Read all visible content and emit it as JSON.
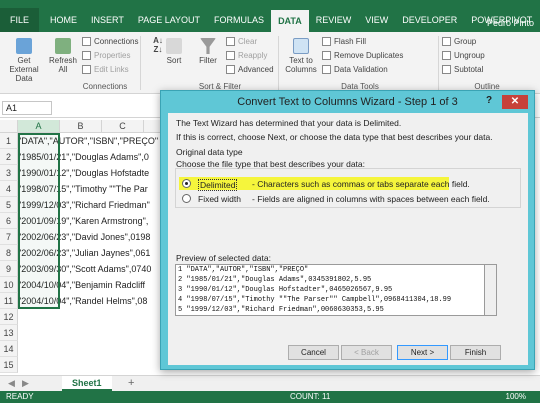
{
  "app": {
    "title_partial": "Book1 - Exc",
    "user": "Pedro Pinto"
  },
  "ribbon_tabs": [
    "FILE",
    "HOME",
    "INSERT",
    "PAGE LAYOUT",
    "FORMULAS",
    "DATA",
    "REVIEW",
    "VIEW",
    "DEVELOPER",
    "POWERPIVOT"
  ],
  "active_tab": "DATA",
  "ribbon": {
    "get_external_data": "Get External Data",
    "refresh_all": "Refresh All",
    "connections": "Connections",
    "properties": "Properties",
    "edit_links": "Edit Links",
    "group_connections": "Connections",
    "sort": "Sort",
    "filter": "Filter",
    "clear": "Clear",
    "reapply": "Reapply",
    "advanced": "Advanced",
    "group_sort_filter": "Sort & Filter",
    "text_to_columns": "Text to Columns",
    "flash_fill": "Flash Fill",
    "remove_duplicates": "Remove Duplicates",
    "data_validation": "Data Validation",
    "group_data_tools": "Data Tools",
    "group": "Group",
    "ungroup": "Ungroup",
    "subtotal": "Subtotal",
    "group_outline": "Outline"
  },
  "name_box": "A1",
  "columns": [
    "A",
    "B",
    "C"
  ],
  "rows": [
    {
      "n": "1",
      "v": "\"DATA\",\"AUTOR\",\"ISBN\",\"PREÇO\""
    },
    {
      "n": "2",
      "v": "\"1985/01/21\",\"Douglas Adams\",0"
    },
    {
      "n": "3",
      "v": "\"1990/01/12\",\"Douglas Hofstadte"
    },
    {
      "n": "4",
      "v": "\"1998/07/15\",\"Timothy \"\"The Par"
    },
    {
      "n": "5",
      "v": "\"1999/12/03\",\"Richard Friedman\""
    },
    {
      "n": "6",
      "v": "\"2001/09/19\",\"Karen Armstrong\","
    },
    {
      "n": "7",
      "v": "\"2002/06/23\",\"David Jones\",0198"
    },
    {
      "n": "8",
      "v": "\"2002/06/23\",\"Julian Jaynes\",061"
    },
    {
      "n": "9",
      "v": "\"2003/09/30\",\"Scott Adams\",0740"
    },
    {
      "n": "10",
      "v": "\"2004/10/04\",\"Benjamin Radcliff"
    },
    {
      "n": "11",
      "v": "\"2004/10/04\",\"Randel Helms\",08"
    },
    {
      "n": "12",
      "v": ""
    },
    {
      "n": "13",
      "v": ""
    },
    {
      "n": "14",
      "v": ""
    },
    {
      "n": "15",
      "v": ""
    }
  ],
  "sheet_tab": "Sheet1",
  "add_sheet": "+",
  "status": {
    "ready": "READY",
    "count": "COUNT: 11",
    "zoom": "100%"
  },
  "dialog": {
    "title": "Convert Text to Columns Wizard - Step 1 of 3",
    "help": "?",
    "close": "✕",
    "line1": "The Text Wizard has determined that your data is Delimited.",
    "line2": "If this is correct, choose Next, or choose the data type that best describes your data.",
    "original_data_type": "Original data type",
    "choose_file_type": "Choose the file type that best describes your data:",
    "delimited": "Delimited",
    "delimited_desc": "- Characters such as commas or tabs separate each field.",
    "fixed_width": "Fixed width",
    "fixed_width_desc": "- Fields are aligned in columns with spaces between each field.",
    "preview_label": "Preview of selected data:",
    "preview": [
      "1 \"DATA\",\"AUTOR\",\"ISBN\",\"PREÇO\"",
      "2 \"1985/01/21\",\"Douglas Adams\",0345391802,5.95",
      "3 \"1990/01/12\",\"Douglas Hofstadter\",0465026567,9.95",
      "4 \"1998/07/15\",\"Timothy \"\"The Parser\"\" Campbell\",0968411304,18.99",
      "5 \"1999/12/03\",\"Richard Friedman\",0060630353,5.95"
    ],
    "cancel": "Cancel",
    "back": "< Back",
    "next": "Next >",
    "finish": "Finish"
  }
}
